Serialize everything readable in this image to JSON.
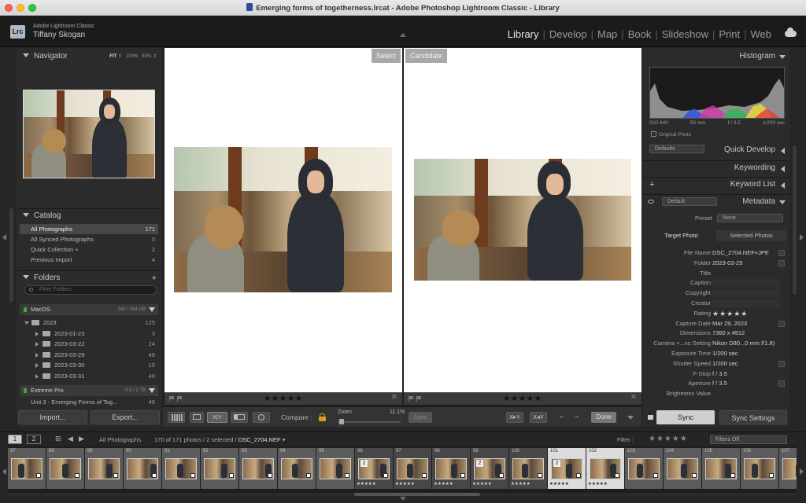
{
  "window": {
    "title": "Emerging forms of togetherness.lrcat - Adobe Photoshop Lightroom Classic - Library"
  },
  "identity": {
    "logo": "Lrc",
    "brand": "Adobe Lightroom Classic",
    "user": "Tiffany Skogan"
  },
  "modules": [
    {
      "label": "Library",
      "active": true
    },
    {
      "label": "Develop"
    },
    {
      "label": "Map"
    },
    {
      "label": "Book"
    },
    {
      "label": "Slideshow"
    },
    {
      "label": "Print"
    },
    {
      "label": "Web"
    }
  ],
  "navigator": {
    "title": "Navigator",
    "fit": "FIT",
    "zoom1": "100%",
    "zoom2": "50%"
  },
  "catalog": {
    "title": "Catalog",
    "items": [
      {
        "label": "All Photographs",
        "count": "171",
        "selected": true
      },
      {
        "label": "All Synced Photographs",
        "count": "0"
      },
      {
        "label": "Quick Collection +",
        "count": "2"
      },
      {
        "label": "Previous Import",
        "count": "4"
      }
    ]
  },
  "folders": {
    "title": "Folders",
    "plus": "+",
    "search_placeholder": "Filter Folders",
    "volume1": {
      "name": "MacOS",
      "capacity": "340 / 494 GB"
    },
    "tree": [
      {
        "label": "2023",
        "count": "125"
      },
      {
        "label": "2023-01-23",
        "count": "3"
      },
      {
        "label": "2023-03-22",
        "count": "24"
      },
      {
        "label": "2023-03-29",
        "count": "48"
      },
      {
        "label": "2023-03-30",
        "count": "10"
      },
      {
        "label": "2023-03-31",
        "count": "40"
      }
    ],
    "volume2": {
      "name": "Extreme Pro",
      "capacity": "0.9 / 1 TB"
    },
    "partial": {
      "label": "Unit 3 - Emerging Forms of Tog...",
      "count": "46"
    }
  },
  "left_buttons": {
    "import": "Import...",
    "export": "Export..."
  },
  "compare": {
    "select_tag": "Select",
    "candidate_tag": "Candidate",
    "select_rating": "★★★★★",
    "candidate_rating": "★★★★★",
    "close": "✕"
  },
  "toolbar": {
    "compare_label": "Compare :",
    "zoom_label": "Zoom",
    "zoom_value": "11.1%",
    "sync": "Sync",
    "done": "Done",
    "xy": "X|Y",
    "swap1": "X▸Y",
    "swap2": "X◂Y",
    "prev": "←",
    "next": "→"
  },
  "right": {
    "histogram": "Histogram",
    "exif": {
      "iso": "ISO 640",
      "focal": "50 mm",
      "fstop": "f / 3.5",
      "shutter": "1/200 sec"
    },
    "original_photo": "Original Photo",
    "defaults": "Defaults",
    "quick_develop": "Quick Develop",
    "keywording": "Keywording",
    "keyword_list": "Keyword List",
    "keyword_plus": "+",
    "default_preset": "Default",
    "metadata": "Metadata",
    "preset_label": "Preset",
    "preset_value": "None",
    "tab_target": "Target Photo",
    "tab_selected": "Selected Photos",
    "fields": [
      {
        "k": "File Name",
        "v": "DSC_2704.NEF+JPE"
      },
      {
        "k": "Folder",
        "v": "2023-03-29"
      },
      {
        "k": "Title",
        "v": ""
      },
      {
        "k": "Caption",
        "v": ""
      },
      {
        "k": "Copyright",
        "v": ""
      },
      {
        "k": "Creator",
        "v": ""
      },
      {
        "k": "Rating",
        "v": "★★★★★"
      },
      {
        "k": "Capture Date",
        "v": "Mar 29, 2023"
      },
      {
        "k": "Dimensions",
        "v": "7360 x 4912"
      },
      {
        "k": "Camera +...ns Setting",
        "v": "Nikon D80...0 mm f/1.8)"
      },
      {
        "k": "Exposure Time",
        "v": "1/200 sec"
      },
      {
        "k": "Shutter Speed",
        "v": "1/200 sec"
      },
      {
        "k": "F-Stop",
        "v": "f / 3.5"
      },
      {
        "k": "Aperture",
        "v": "f / 3.5"
      },
      {
        "k": "Brightness Value",
        "v": ""
      }
    ],
    "sync_btn": "Sync",
    "sync_settings": "Sync Settings"
  },
  "filmbar": {
    "page1": "1",
    "page2": "2",
    "source": "All Photographs",
    "info": "170 of 171 photos / 2 selected / ",
    "file": "DSC_2704.NEF",
    "caret": "▾",
    "filter_label": "Filter :",
    "filter_stars": "★★★★★",
    "filter_value": "Filters Off"
  },
  "filmstrip": [
    {
      "n": "87"
    },
    {
      "n": "88"
    },
    {
      "n": "89"
    },
    {
      "n": "90"
    },
    {
      "n": "91"
    },
    {
      "n": "92"
    },
    {
      "n": "93"
    },
    {
      "n": "94"
    },
    {
      "n": "95"
    },
    {
      "n": "96",
      "badge": "2",
      "stars": "★★★★★",
      "dark": true
    },
    {
      "n": "97",
      "stars": "★★★★★",
      "dark": true
    },
    {
      "n": "98",
      "stars": "★★★★★",
      "dark": true
    },
    {
      "n": "99",
      "badge": "2",
      "stars": "★★★★★",
      "dark": true
    },
    {
      "n": "100",
      "stars": "★★★★★",
      "dark": true
    },
    {
      "n": "101",
      "badge": "2",
      "stars": "★★★★★",
      "sel": true
    },
    {
      "n": "102",
      "stars": "★★★★★",
      "sel": true
    },
    {
      "n": "103"
    },
    {
      "n": "104"
    },
    {
      "n": "105"
    },
    {
      "n": "106"
    },
    {
      "n": "107"
    }
  ]
}
